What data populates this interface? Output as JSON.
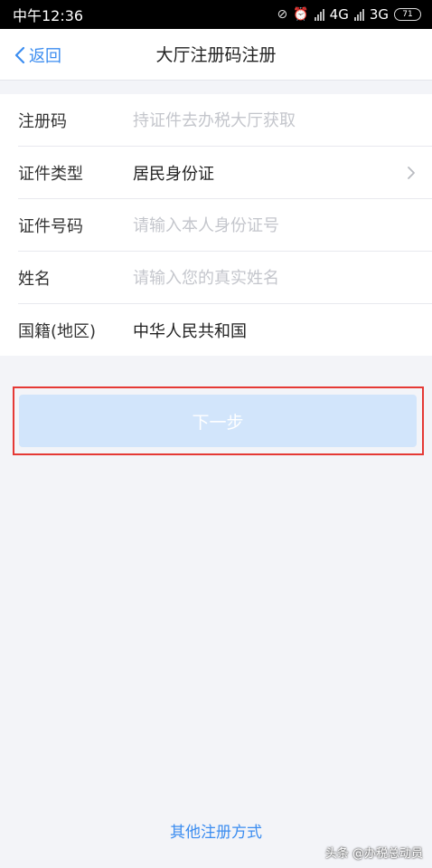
{
  "status_bar": {
    "time": "中午12:36",
    "network1": "4G",
    "network2": "3G",
    "battery": "71"
  },
  "nav": {
    "back_label": "返回",
    "title": "大厅注册码注册"
  },
  "form": {
    "rows": [
      {
        "label": "注册码",
        "placeholder": "持证件去办税大厅获取",
        "value": ""
      },
      {
        "label": "证件类型",
        "value": "居民身份证"
      },
      {
        "label": "证件号码",
        "placeholder": "请输入本人身份证号",
        "value": ""
      },
      {
        "label": "姓名",
        "placeholder": "请输入您的真实姓名",
        "value": ""
      },
      {
        "label": "国籍(地区)",
        "value": "中华人民共和国"
      }
    ]
  },
  "actions": {
    "next_label": "下一步",
    "other_methods_label": "其他注册方式"
  },
  "watermark": "头条 @办税总动员",
  "colors": {
    "accent": "#3c8df0",
    "button_disabled": "#d2e5fb",
    "highlight_border": "#e53935",
    "background": "#f3f4f8"
  }
}
